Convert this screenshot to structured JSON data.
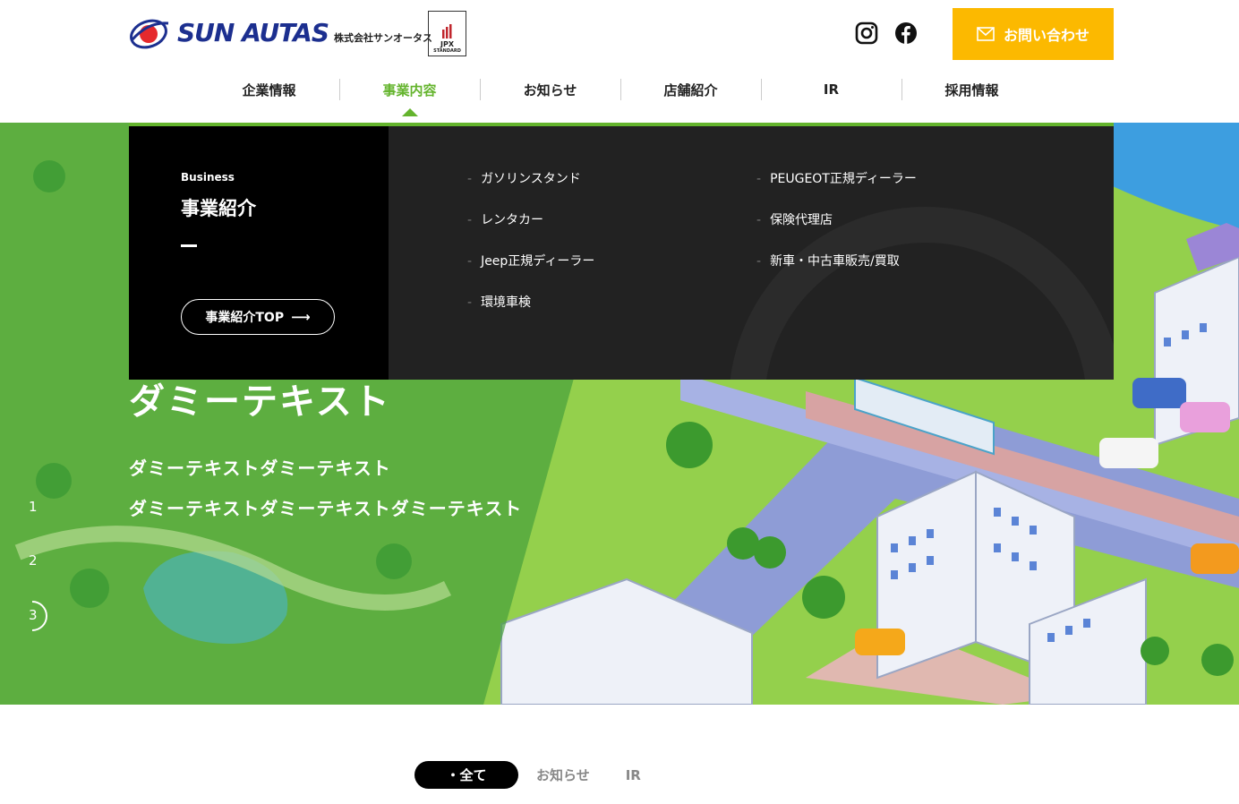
{
  "header": {
    "logo_text": "SUN AUTAS",
    "company_name": "株式会社サンオータス",
    "jpx_label": "JPX",
    "jpx_sub": "STANDARD",
    "contact_label": "お問い合わせ",
    "brand_yellow": "#fcb900",
    "brand_green": "#64b42d"
  },
  "nav": {
    "items": [
      {
        "label": "企業情報"
      },
      {
        "label": "事業内容"
      },
      {
        "label": "お知らせ"
      },
      {
        "label": "店舗紹介"
      },
      {
        "label": "IR"
      },
      {
        "label": "採用情報"
      }
    ],
    "active_index": 1
  },
  "mega_menu": {
    "en_label": "Business",
    "title": "事業紹介",
    "top_button": "事業紹介TOP",
    "links_col1": [
      "ガソリンスタンド",
      "レンタカー",
      "Jeep正規ディーラー",
      "環境車検"
    ],
    "links_col2": [
      "PEUGEOT正規ディーラー",
      "保険代理店",
      "新車・中古車販売/買取"
    ],
    "bullet": "-"
  },
  "hero": {
    "title": "ダミーテキスト",
    "line1": "ダミーテキストダミーテキスト",
    "line2": "ダミーテキストダミーテキストダミーテキスト",
    "pager": [
      "1",
      "2",
      "3"
    ]
  },
  "news_tabs": {
    "items": [
      "・全て",
      "お知らせ",
      "IR"
    ]
  }
}
